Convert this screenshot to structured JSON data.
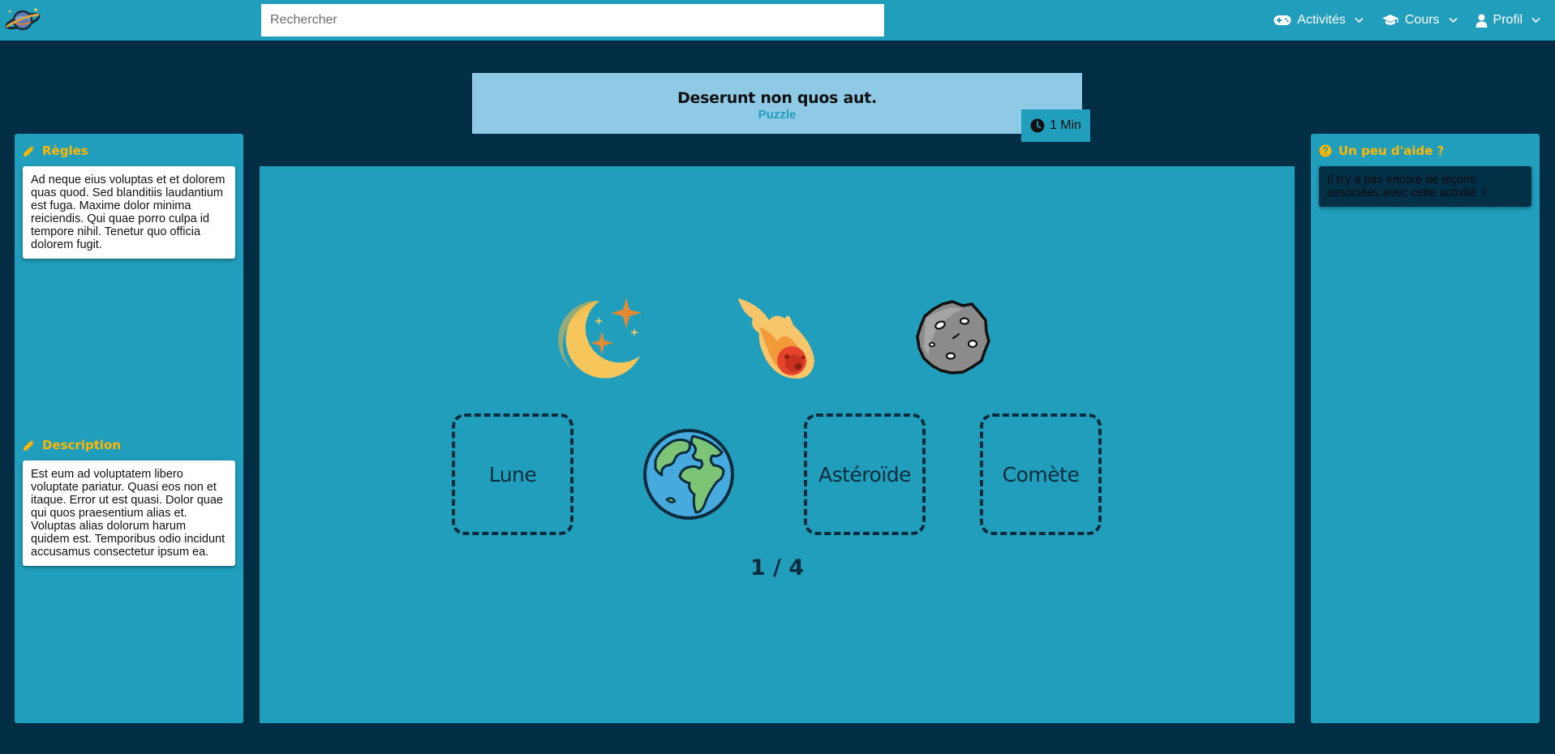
{
  "navbar": {
    "search_placeholder": "Rechercher",
    "menu": [
      {
        "label": "Activités",
        "icon": "gamepad-icon"
      },
      {
        "label": "Cours",
        "icon": "graduation-cap-icon"
      },
      {
        "label": "Profil",
        "icon": "user-icon"
      }
    ]
  },
  "activity": {
    "title": "Deserunt non quos aut.",
    "type": "Puzzle",
    "timer": "1 Min"
  },
  "rules": {
    "heading": "Règles",
    "text": "Ad neque eius voluptas et et dolorem quas quod. Sed blanditiis laudantium est fuga. Maxime dolor minima reiciendis. Qui quae porro culpa id tempore nihil. Tenetur quo officia dolorem fugit."
  },
  "description": {
    "heading": "Description",
    "text": "Est eum ad voluptatem libero voluptate pariatur. Quasi eos non et itaque. Error ut est quasi. Dolor quae qui quos praesentium alias et. Voluptas alias dolorum harum quidem est. Temporibus odio incidunt accusamus consectetur ipsum ea."
  },
  "help": {
    "heading": "Un peu d'aide ?",
    "text": "Il n'y a pas encore de leçons associées avec cette activité :/"
  },
  "puzzle": {
    "pieces": [
      {
        "name": "moon-stars-icon"
      },
      {
        "name": "comet-icon"
      },
      {
        "name": "asteroid-icon"
      },
      {
        "name": "earth-icon"
      }
    ],
    "dropzones": [
      "Lune",
      "Astéroïde",
      "Comète"
    ],
    "progress": "1 / 4"
  },
  "colors": {
    "background": "#022e45",
    "primary": "#219ebc",
    "banner": "#8ecae6",
    "accent": "#ffb703"
  }
}
